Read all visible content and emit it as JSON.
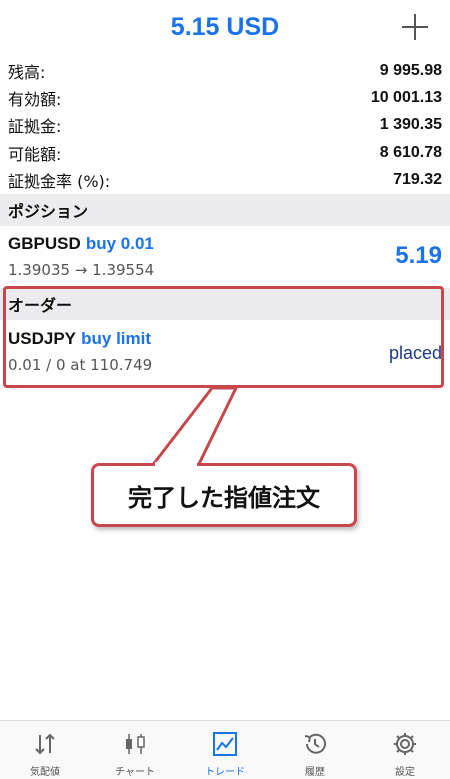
{
  "header": {
    "title": "5.15 USD",
    "add_icon": "plus-icon"
  },
  "balance": [
    {
      "label": "残高:",
      "value": "9 995.98"
    },
    {
      "label": "有効額:",
      "value": "10 001.13"
    },
    {
      "label": "証拠金:",
      "value": "1 390.35"
    },
    {
      "label": "可能額:",
      "value": "8 610.78"
    },
    {
      "label": "証拠金率 (%):",
      "value": "719.32"
    }
  ],
  "positions": {
    "header": "ポジション",
    "items": [
      {
        "symbol": "GBPUSD",
        "side": "buy 0.01",
        "detail": "1.39035 → 1.39554",
        "profit": "5.19"
      }
    ]
  },
  "orders": {
    "header": "オーダー",
    "items": [
      {
        "symbol": "USDJPY",
        "side": "buy limit",
        "detail": "0.01 / 0 at 110.749",
        "status": "placed"
      }
    ]
  },
  "callout": {
    "text": "完了した指値注文"
  },
  "tabs": [
    {
      "label": "気配値",
      "icon": "arrows-updown-icon",
      "active": false
    },
    {
      "label": "チャート",
      "icon": "candlestick-icon",
      "active": false
    },
    {
      "label": "トレード",
      "icon": "trade-chart-icon",
      "active": true
    },
    {
      "label": "履歴",
      "icon": "history-icon",
      "active": false
    },
    {
      "label": "設定",
      "icon": "gear-icon",
      "active": false
    }
  ],
  "colors": {
    "accent": "#1a73e8",
    "highlight": "#c8474c",
    "order_status": "#1a3a8a"
  }
}
